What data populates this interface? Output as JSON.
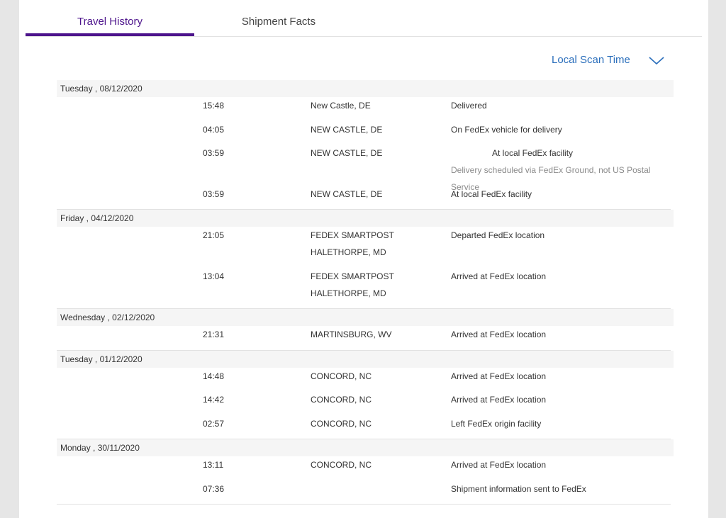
{
  "tabs": {
    "travel_history": "Travel History",
    "shipment_facts": "Shipment Facts"
  },
  "scan_time_toggle": {
    "label": "Local Scan Time",
    "icon": "chevron-down-icon"
  },
  "colors": {
    "accent_purple": "#4d148c",
    "link_blue": "#2a6ebb"
  },
  "history": [
    {
      "date": "Tuesday , 08/12/2020",
      "events": [
        {
          "time": "15:48",
          "location": [
            "New Castle, DE"
          ],
          "status": "Delivered"
        },
        {
          "time": "04:05",
          "location": [
            "NEW CASTLE, DE"
          ],
          "status": "On FedEx vehicle for delivery"
        },
        {
          "time": "03:59",
          "location": [
            "NEW CASTLE, DE"
          ],
          "status": "At local FedEx facility",
          "status_indent": true,
          "note": "Delivery scheduled via FedEx Ground, not US Postal Service"
        },
        {
          "time": "03:59",
          "location": [
            "NEW CASTLE, DE"
          ],
          "status": "At local FedEx facility"
        }
      ]
    },
    {
      "date": "Friday , 04/12/2020",
      "events": [
        {
          "time": "21:05",
          "location": [
            "FEDEX SMARTPOST",
            "HALETHORPE, MD"
          ],
          "status": "Departed FedEx location"
        },
        {
          "time": "13:04",
          "location": [
            "FEDEX SMARTPOST",
            "HALETHORPE, MD"
          ],
          "status": "Arrived at FedEx location"
        }
      ]
    },
    {
      "date": "Wednesday , 02/12/2020",
      "events": [
        {
          "time": "21:31",
          "location": [
            "MARTINSBURG, WV"
          ],
          "status": "Arrived at FedEx location"
        }
      ]
    },
    {
      "date": "Tuesday , 01/12/2020",
      "events": [
        {
          "time": "14:48",
          "location": [
            "CONCORD, NC"
          ],
          "status": "Arrived at FedEx location"
        },
        {
          "time": "14:42",
          "location": [
            "CONCORD, NC"
          ],
          "status": "Arrived at FedEx location"
        },
        {
          "time": "02:57",
          "location": [
            "CONCORD, NC"
          ],
          "status": "Left FedEx origin facility"
        }
      ]
    },
    {
      "date": "Monday , 30/11/2020",
      "events": [
        {
          "time": "13:11",
          "location": [
            "CONCORD, NC"
          ],
          "status": "Arrived at FedEx location"
        },
        {
          "time": "07:36",
          "location": [],
          "status": "Shipment information sent to FedEx"
        }
      ]
    }
  ]
}
